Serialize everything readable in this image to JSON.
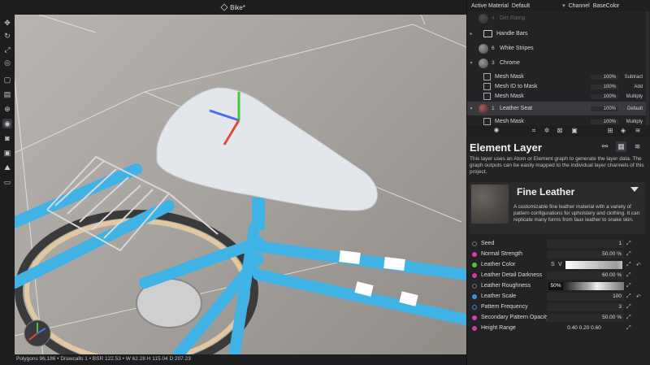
{
  "title": {
    "document": "Bike*",
    "cube_icon": "scene-cube-icon"
  },
  "active_material": {
    "label": "Active Material",
    "value": "Default"
  },
  "channel": {
    "label": "Channel",
    "value": "BaseColor"
  },
  "layers": [
    {
      "name": "Dirt Ramp",
      "num": "4"
    },
    {
      "name": "Handle Bars"
    },
    {
      "name": "White Stripes",
      "num": "6"
    },
    {
      "name": "Chrome",
      "num": "3"
    },
    {
      "name": "Mesh Mask",
      "pct": "100%",
      "mode": "Subtract"
    },
    {
      "name": "Mesh ID to Mask",
      "pct": "100%",
      "mode": "Add"
    },
    {
      "name": "Mesh Mask",
      "pct": "100%",
      "mode": "Multiply"
    },
    {
      "name": "Leather Seat",
      "num": "1",
      "pct": "100%",
      "mode": "Default"
    },
    {
      "name": "Mesh Mask",
      "pct": "100%",
      "mode": "Multiply"
    }
  ],
  "element_layer": {
    "title": "Element Layer",
    "description": "This layer uses an Atom or Element graph to generate the layer data. The graph outputs can be easily mapped to the individual layer channels of this project."
  },
  "preset": {
    "name": "Fine Leather",
    "description": "A customizable fine leather material with a variety of pattern configurations for upholstery and clothing. It can replicate many forms from faux leather to snake skin."
  },
  "properties": [
    {
      "label": "Seed",
      "value": "1",
      "color": "#2a2a2d"
    },
    {
      "label": "Normal Strength",
      "value": "50.00 %",
      "color": "#d63ca8"
    },
    {
      "label": "Leather Color",
      "value": "",
      "color": "#4dc24d"
    },
    {
      "label": "Leather Detail Darkness",
      "value": "60.00 %",
      "color": "#d63ca8"
    },
    {
      "label": "Leather Roughness",
      "value": "50%",
      "color": "#2a2a2d"
    },
    {
      "label": "Leather Scale",
      "value": "100",
      "color": "#3c8fd6"
    },
    {
      "label": "Pattern Frequency",
      "value": "3",
      "color": "#2a2a2d"
    },
    {
      "label": "Secondary Pattern Opacity",
      "value": "50.00 %",
      "color": "#d63ca8"
    },
    {
      "label": "Height Range",
      "value": "0.40   0.20   0.60",
      "color": "#d63ca8"
    }
  ],
  "leather_color_sv": {
    "s": "S",
    "v": "V"
  },
  "status_bar": "Polygons 96,186 • Drawcalls 1 • BSR 122.53 • W 62.28 H 115.04 D 207.23"
}
